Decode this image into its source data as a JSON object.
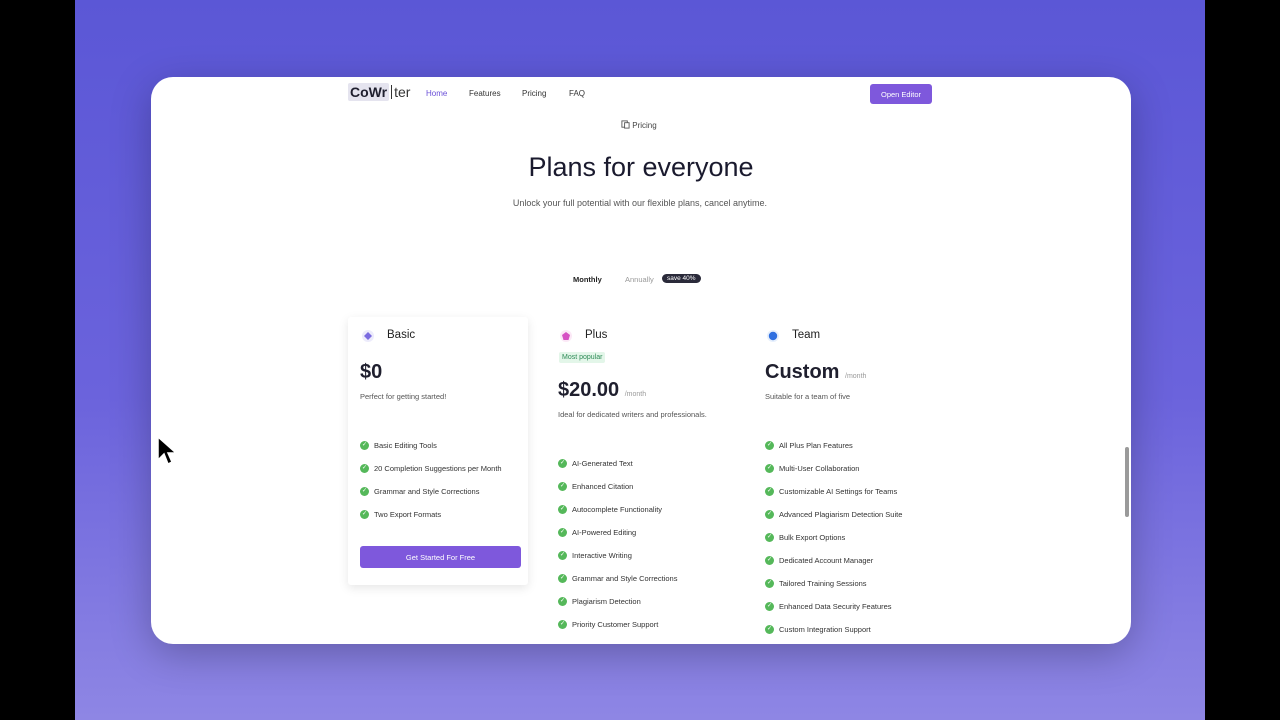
{
  "colors": {
    "accent": "#7e58dc",
    "check": "#55b85a",
    "background": "#5b57d6"
  },
  "nav": {
    "logo_box": "CoWr",
    "logo_rest": "ter",
    "links": [
      "Home",
      "Features",
      "Pricing",
      "FAQ"
    ],
    "active": "Home",
    "cta": "Open Editor"
  },
  "hero": {
    "pill_icon": "pricing-tag-icon",
    "pill": "Pricing",
    "title": "Plans for everyone",
    "subtitle": "Unlock your full potential with our flexible plans, cancel anytime."
  },
  "billing_toggle": {
    "monthly": "Monthly",
    "annually": "Annually",
    "badge": "save 40%",
    "selected": "Monthly"
  },
  "plans": {
    "basic": {
      "name": "Basic",
      "icon": "diamond-icon",
      "price": "$0",
      "description": "Perfect for getting started!",
      "features": [
        "Basic Editing Tools",
        "20 Completion Suggestions per Month",
        "Grammar and Style Corrections",
        "Two Export Formats"
      ],
      "cta": "Get Started For Free"
    },
    "plus": {
      "name": "Plus",
      "icon": "pentagon-icon",
      "badge": "Most popular",
      "price": "$20.00",
      "per": "/month",
      "description": "Ideal for dedicated writers and professionals.",
      "features": [
        "AI-Generated Text",
        "Enhanced Citation",
        "Autocomplete Functionality",
        "AI-Powered Editing",
        "Interactive Writing",
        "Grammar and Style Corrections",
        "Plagiarism Detection",
        "Priority Customer Support"
      ]
    },
    "team": {
      "name": "Team",
      "icon": "circle-icon",
      "price": "Custom",
      "per": "/month",
      "description": "Suitable for a team of five",
      "features": [
        "All Plus Plan Features",
        "Multi-User Collaboration",
        "Customizable AI Settings for Teams",
        "Advanced Plagiarism Detection Suite",
        "Bulk Export Options",
        "Dedicated Account Manager",
        "Tailored Training Sessions",
        "Enhanced Data Security Features",
        "Custom Integration Support"
      ]
    }
  }
}
